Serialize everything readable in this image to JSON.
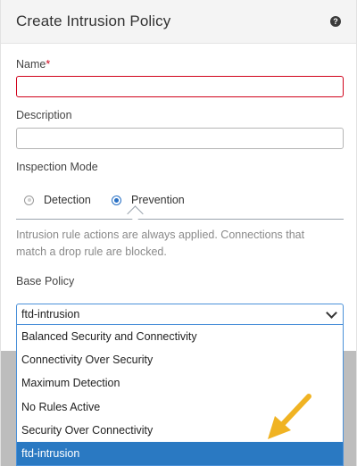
{
  "dialog": {
    "title": "Create Intrusion Policy",
    "help_icon": "?"
  },
  "form": {
    "name_label": "Name",
    "name_required_mark": "*",
    "name_value": "",
    "description_label": "Description",
    "description_value": "",
    "inspection_mode_label": "Inspection Mode",
    "inspection_modes": [
      {
        "label": "Detection",
        "checked": false
      },
      {
        "label": "Prevention",
        "checked": true
      }
    ],
    "mode_help_text": "Intrusion rule actions are always applied. Connections that match a drop rule are blocked.",
    "base_policy_label": "Base Policy",
    "base_policy_selected": "ftd-intrusion",
    "base_policy_options": [
      "Balanced Security and Connectivity",
      "Connectivity Over Security",
      "Maximum Detection",
      "No Rules Active",
      "Security Over Connectivity",
      "ftd-intrusion"
    ]
  },
  "colors": {
    "accent": "#2a79c2",
    "error": "#d0021b",
    "annotation_arrow": "#f0b323"
  },
  "icons": [
    "help-icon",
    "chevron-down-icon",
    "annotation-arrow-icon"
  ]
}
